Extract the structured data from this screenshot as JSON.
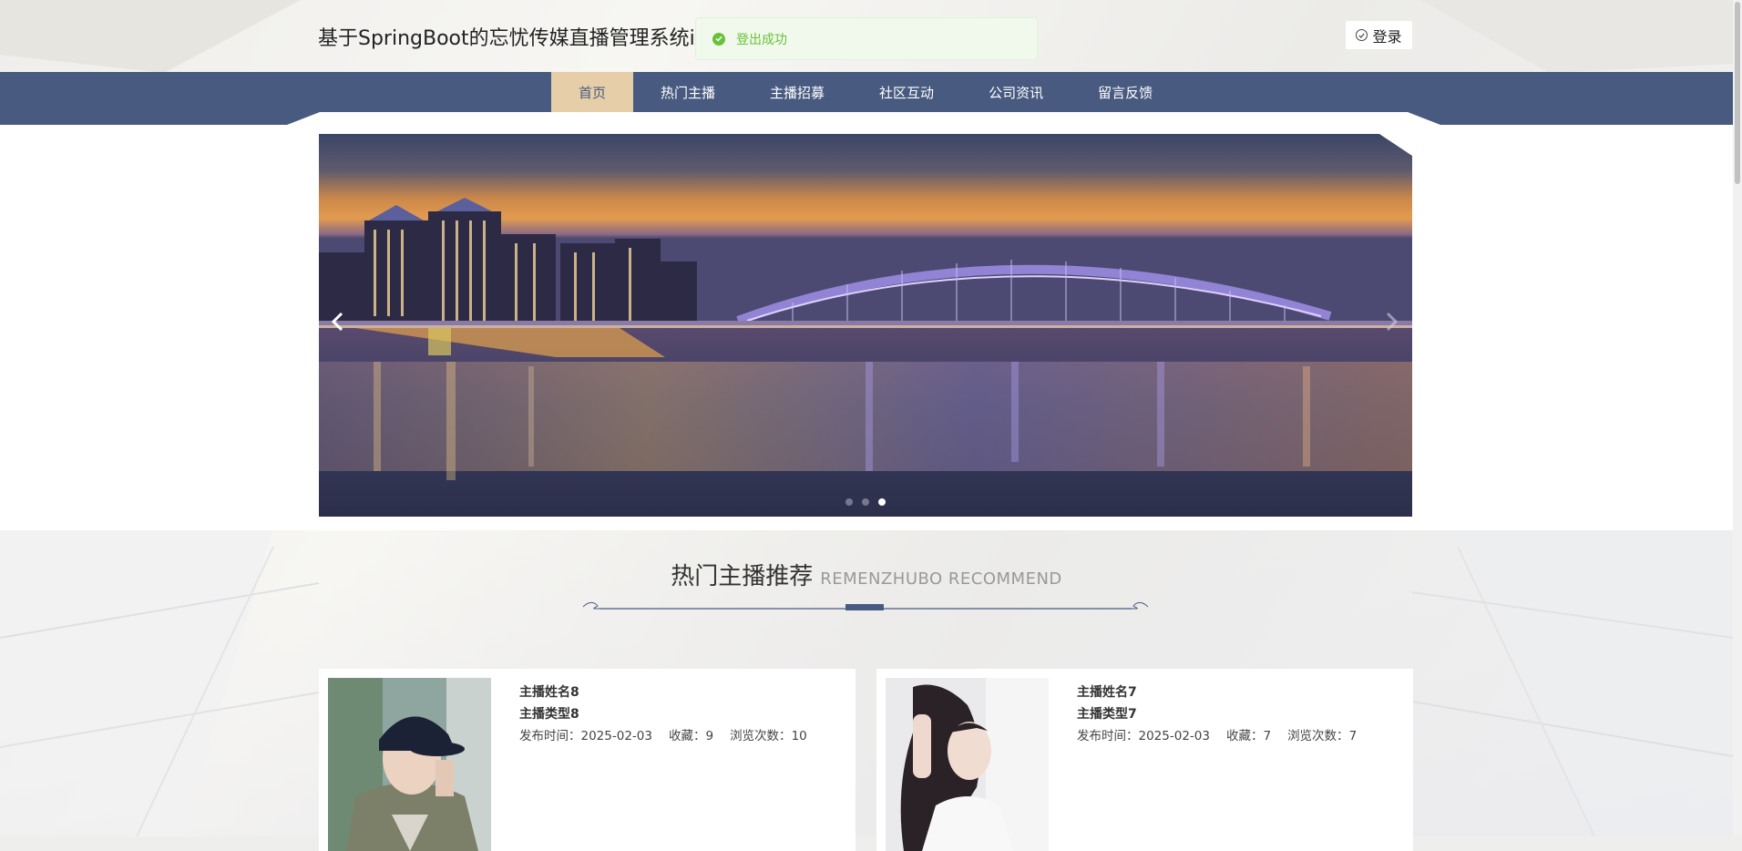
{
  "header": {
    "site_title": "基于SpringBoot的忘忧传媒直播管理系统i",
    "login_label": "登录"
  },
  "toast": {
    "message": "登出成功"
  },
  "nav": {
    "tabs": [
      {
        "label": "首页",
        "active": true
      },
      {
        "label": "热门主播",
        "active": false
      },
      {
        "label": "主播招募",
        "active": false
      },
      {
        "label": "社区互动",
        "active": false
      },
      {
        "label": "公司资讯",
        "active": false
      },
      {
        "label": "留言反馈",
        "active": false
      }
    ]
  },
  "carousel": {
    "active_slide": 3,
    "slide_count": 3
  },
  "section": {
    "title_cn": "热门主播推荐",
    "title_en": "REMENZHUBO RECOMMEND"
  },
  "cards": [
    {
      "name": "主播姓名8",
      "type": "主播类型8",
      "publish_label": "发布时间：",
      "publish_date": "2025-02-03",
      "fav_label": "收藏：",
      "fav_count": "9",
      "views_label": "浏览次数：",
      "views_count": "10"
    },
    {
      "name": "主播姓名7",
      "type": "主播类型7",
      "publish_label": "发布时间：",
      "publish_date": "2025-02-03",
      "fav_label": "收藏：",
      "fav_count": "7",
      "views_label": "浏览次数：",
      "views_count": "7"
    }
  ],
  "colors": {
    "nav_bg": "#485a80",
    "nav_active": "#e6cfa8",
    "toast_text": "#67c23a",
    "toast_bg": "#f0f9eb"
  }
}
